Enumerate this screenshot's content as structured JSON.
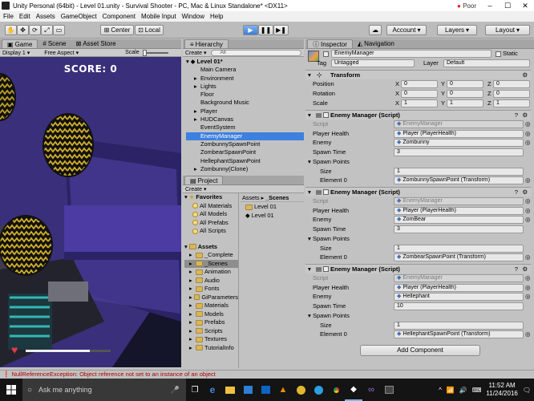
{
  "window": {
    "title": "Unity Personal (64bit) - Level 01.unity - Survival Shooter - PC, Mac & Linux Standalone* <DX11>",
    "network": "Poor"
  },
  "menu": [
    "File",
    "Edit",
    "Assets",
    "GameObject",
    "Component",
    "Mobile Input",
    "Window",
    "Help"
  ],
  "toolbar": {
    "pivot": "Center",
    "space": "Local",
    "account": "Account",
    "layers": "Layers",
    "layout": "Layout"
  },
  "game": {
    "tabs": [
      "Game",
      "Scene",
      "Asset Store"
    ],
    "display": "Display 1",
    "aspect": "Free Aspect",
    "scale_label": "Scale",
    "score": "SCORE: 0",
    "health_fraction": 0.75
  },
  "hierarchy": {
    "tab": "Hierarchy",
    "create": "Create",
    "search_placeholder": "All",
    "scene": "Level 01*",
    "items": [
      {
        "label": "Main Camera",
        "expand": false,
        "selected": false
      },
      {
        "label": "Environment",
        "expand": true,
        "selected": false
      },
      {
        "label": "Lights",
        "expand": true,
        "selected": false
      },
      {
        "label": "Floor",
        "expand": false,
        "selected": false
      },
      {
        "label": "Background Music",
        "expand": false,
        "selected": false
      },
      {
        "label": "Player",
        "expand": true,
        "selected": false
      },
      {
        "label": "HUDCanvas",
        "expand": true,
        "selected": false
      },
      {
        "label": "EventSystem",
        "expand": false,
        "selected": false
      },
      {
        "label": "EnemyManager",
        "expand": false,
        "selected": true
      },
      {
        "label": "ZombunnySpawnPoint",
        "expand": false,
        "selected": false
      },
      {
        "label": "ZombearSpawnPoint",
        "expand": false,
        "selected": false
      },
      {
        "label": "HellephantSpawnPoint",
        "expand": false,
        "selected": false
      },
      {
        "label": "Zombunny(Clone)",
        "expand": true,
        "selected": false
      }
    ]
  },
  "project": {
    "tab": "Project",
    "create": "Create",
    "favorites_label": "Favorites",
    "favorites": [
      "All Materials",
      "All Models",
      "All Prefabs",
      "All Scripts"
    ],
    "assets_label": "Assets",
    "folders": [
      "_Complete",
      "_Scenes",
      "Animation",
      "Audio",
      "Fonts",
      "GiParameters",
      "Materials",
      "Models",
      "Prefabs",
      "Scripts",
      "Textures",
      "TutorialInfo"
    ],
    "selected_folder": "_Scenes",
    "breadcrumb": [
      "Assets",
      "_Scenes"
    ],
    "files": [
      {
        "label": "Level 01",
        "kind": "folder"
      },
      {
        "label": "Level 01",
        "kind": "scene"
      }
    ]
  },
  "inspector": {
    "tabs": [
      "Inspector",
      "Navigation"
    ],
    "object_name": "EnemyManager",
    "static_label": "Static",
    "tag_label": "Tag",
    "tag_value": "Untagged",
    "layer_label": "Layer",
    "layer_value": "Default",
    "transform": {
      "title": "Transform",
      "rows": [
        {
          "label": "Position",
          "x": "0",
          "y": "0",
          "z": "0"
        },
        {
          "label": "Rotation",
          "x": "0",
          "y": "0",
          "z": "0"
        },
        {
          "label": "Scale",
          "x": "1",
          "y": "1",
          "z": "1"
        }
      ]
    },
    "managers": [
      {
        "title": "Enemy Manager (Script)",
        "script": "EnemyManager",
        "player_health": "Player (PlayerHealth)",
        "enemy": "Zombunny",
        "spawn_time": "3",
        "size": "1",
        "element0": "ZombunnySpawnPoint (Transform)"
      },
      {
        "title": "Enemy Manager (Script)",
        "script": "EnemyManager",
        "player_health": "Player (PlayerHealth)",
        "enemy": "ZomBear",
        "spawn_time": "3",
        "size": "1",
        "element0": "ZombearSpawnPoint (Transform)"
      },
      {
        "title": "Enemy Manager (Script)",
        "script": "EnemyManager",
        "player_health": "Player (PlayerHealth)",
        "enemy": "Hellephant",
        "spawn_time": "10",
        "size": "1",
        "element0": "HellephantSpawnPoint (Transform)"
      }
    ],
    "labels": {
      "script": "Script",
      "player_health": "Player Health",
      "enemy": "Enemy",
      "spawn_time": "Spawn Time",
      "spawn_points": "Spawn Points",
      "size": "Size",
      "element0": "Element 0"
    },
    "add_component": "Add Component"
  },
  "status": "NullReferenceException: Object reference not set to an instance of an object",
  "taskbar": {
    "search_placeholder": "Ask me anything",
    "time": "11:52 AM",
    "date": "11/24/2016"
  },
  "colors": {
    "selection": "#3d80df",
    "panel": "#c2c2c2",
    "error": "#b00000",
    "game_floor": "#3a2f7a"
  }
}
